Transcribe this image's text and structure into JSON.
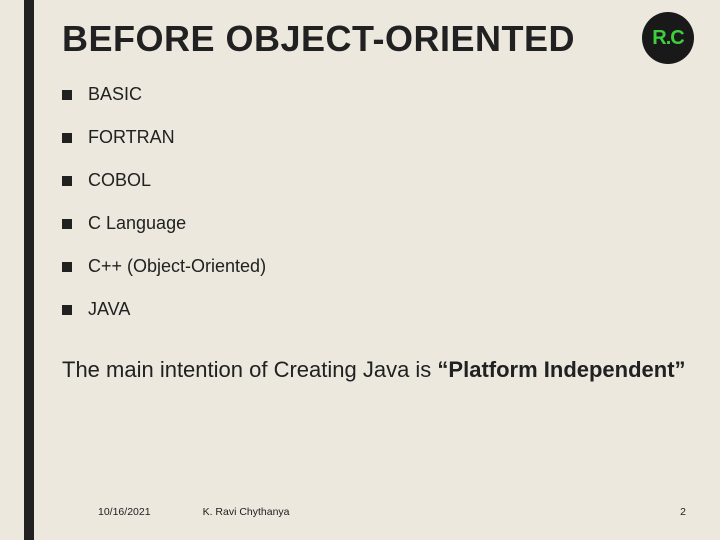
{
  "logo": {
    "text": "R.C"
  },
  "title": "BEFORE OBJECT-ORIENTED",
  "list": [
    "BASIC",
    "FORTRAN",
    "COBOL",
    "C Language",
    "C++ (Object-Oriented)",
    "JAVA"
  ],
  "body": {
    "prefix": "The main intention of Creating Java is ",
    "bold": "“Platform Independent”"
  },
  "footer": {
    "date": "10/16/2021",
    "author": "K. Ravi Chythanya",
    "page": "2"
  }
}
